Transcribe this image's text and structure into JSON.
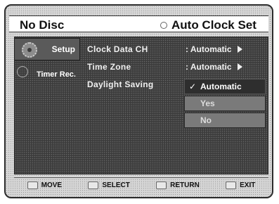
{
  "title": {
    "left": "No Disc",
    "right": "Auto Clock Set"
  },
  "tabs": [
    {
      "label": "Setup",
      "icon": "gear-icon",
      "active": true
    },
    {
      "label": "Timer Rec.",
      "icon": "clock-icon",
      "active": false
    }
  ],
  "settings": [
    {
      "label": "Clock Data CH",
      "value": ": Automatic"
    },
    {
      "label": "Time Zone",
      "value": ": Automatic"
    },
    {
      "label": "Daylight Saving",
      "value": ""
    }
  ],
  "options": [
    {
      "label": "Automatic",
      "selected": true
    },
    {
      "label": "Yes",
      "selected": false
    },
    {
      "label": "No",
      "selected": false
    }
  ],
  "controls": [
    {
      "label": "MOVE"
    },
    {
      "label": "SELECT"
    },
    {
      "label": "RETURN"
    },
    {
      "label": "EXIT"
    }
  ],
  "colors": {
    "panel": "#3c3c3c",
    "text": "#f0f0f0",
    "selected_option": "#2e2e2e",
    "other_option": "#7a7a7a"
  }
}
